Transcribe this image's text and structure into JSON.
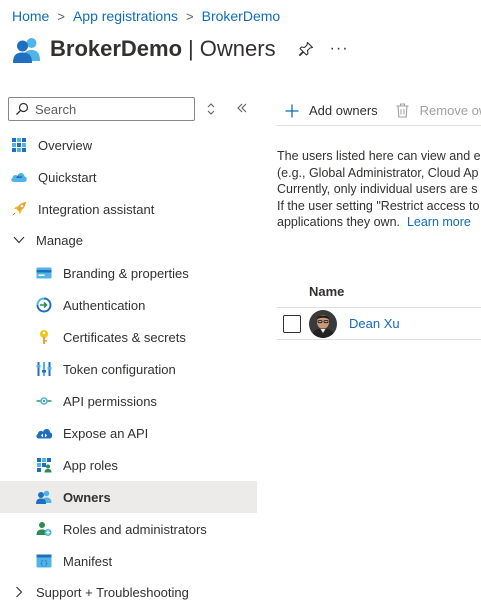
{
  "breadcrumb": {
    "items": [
      "Home",
      "App registrations",
      "BrokerDemo"
    ],
    "separator": ">"
  },
  "header": {
    "app_name": "BrokerDemo",
    "divider": "|",
    "section": "Owners",
    "more": "···"
  },
  "sidebar": {
    "search_placeholder": "Search",
    "items": [
      {
        "label": "Overview",
        "icon": "overview-icon"
      },
      {
        "label": "Quickstart",
        "icon": "quickstart-icon"
      },
      {
        "label": "Integration assistant",
        "icon": "rocket-icon"
      },
      {
        "label": "Manage",
        "icon": "chevron-down-icon"
      },
      {
        "label": "Branding & properties",
        "icon": "branding-icon"
      },
      {
        "label": "Authentication",
        "icon": "authentication-icon"
      },
      {
        "label": "Certificates & secrets",
        "icon": "key-icon"
      },
      {
        "label": "Token configuration",
        "icon": "token-icon"
      },
      {
        "label": "API permissions",
        "icon": "api-permissions-icon"
      },
      {
        "label": "Expose an API",
        "icon": "cloud-icon"
      },
      {
        "label": "App roles",
        "icon": "app-roles-icon"
      },
      {
        "label": "Owners",
        "icon": "owners-icon"
      },
      {
        "label": "Roles and administrators",
        "icon": "roles-admin-icon"
      },
      {
        "label": "Manifest",
        "icon": "manifest-icon"
      },
      {
        "label": "Support + Troubleshooting",
        "icon": "chevron-right-icon"
      }
    ],
    "selected": "Owners"
  },
  "toolbar": {
    "add_label": "Add owners",
    "remove_label": "Remove ow"
  },
  "description": {
    "lines": [
      "The users listed here can view and e",
      "(e.g., Global Administrator, Cloud Ap",
      "Currently, only individual users are s",
      "If the user setting \"Restrict access to",
      "applications they own."
    ],
    "link": "Learn more"
  },
  "table": {
    "columns": [
      "Name"
    ],
    "rows": [
      {
        "name": "Dean Xu"
      }
    ]
  },
  "colors": {
    "link": "#0f6cbd",
    "selected_bg": "#edebe9",
    "text": "#323130"
  }
}
